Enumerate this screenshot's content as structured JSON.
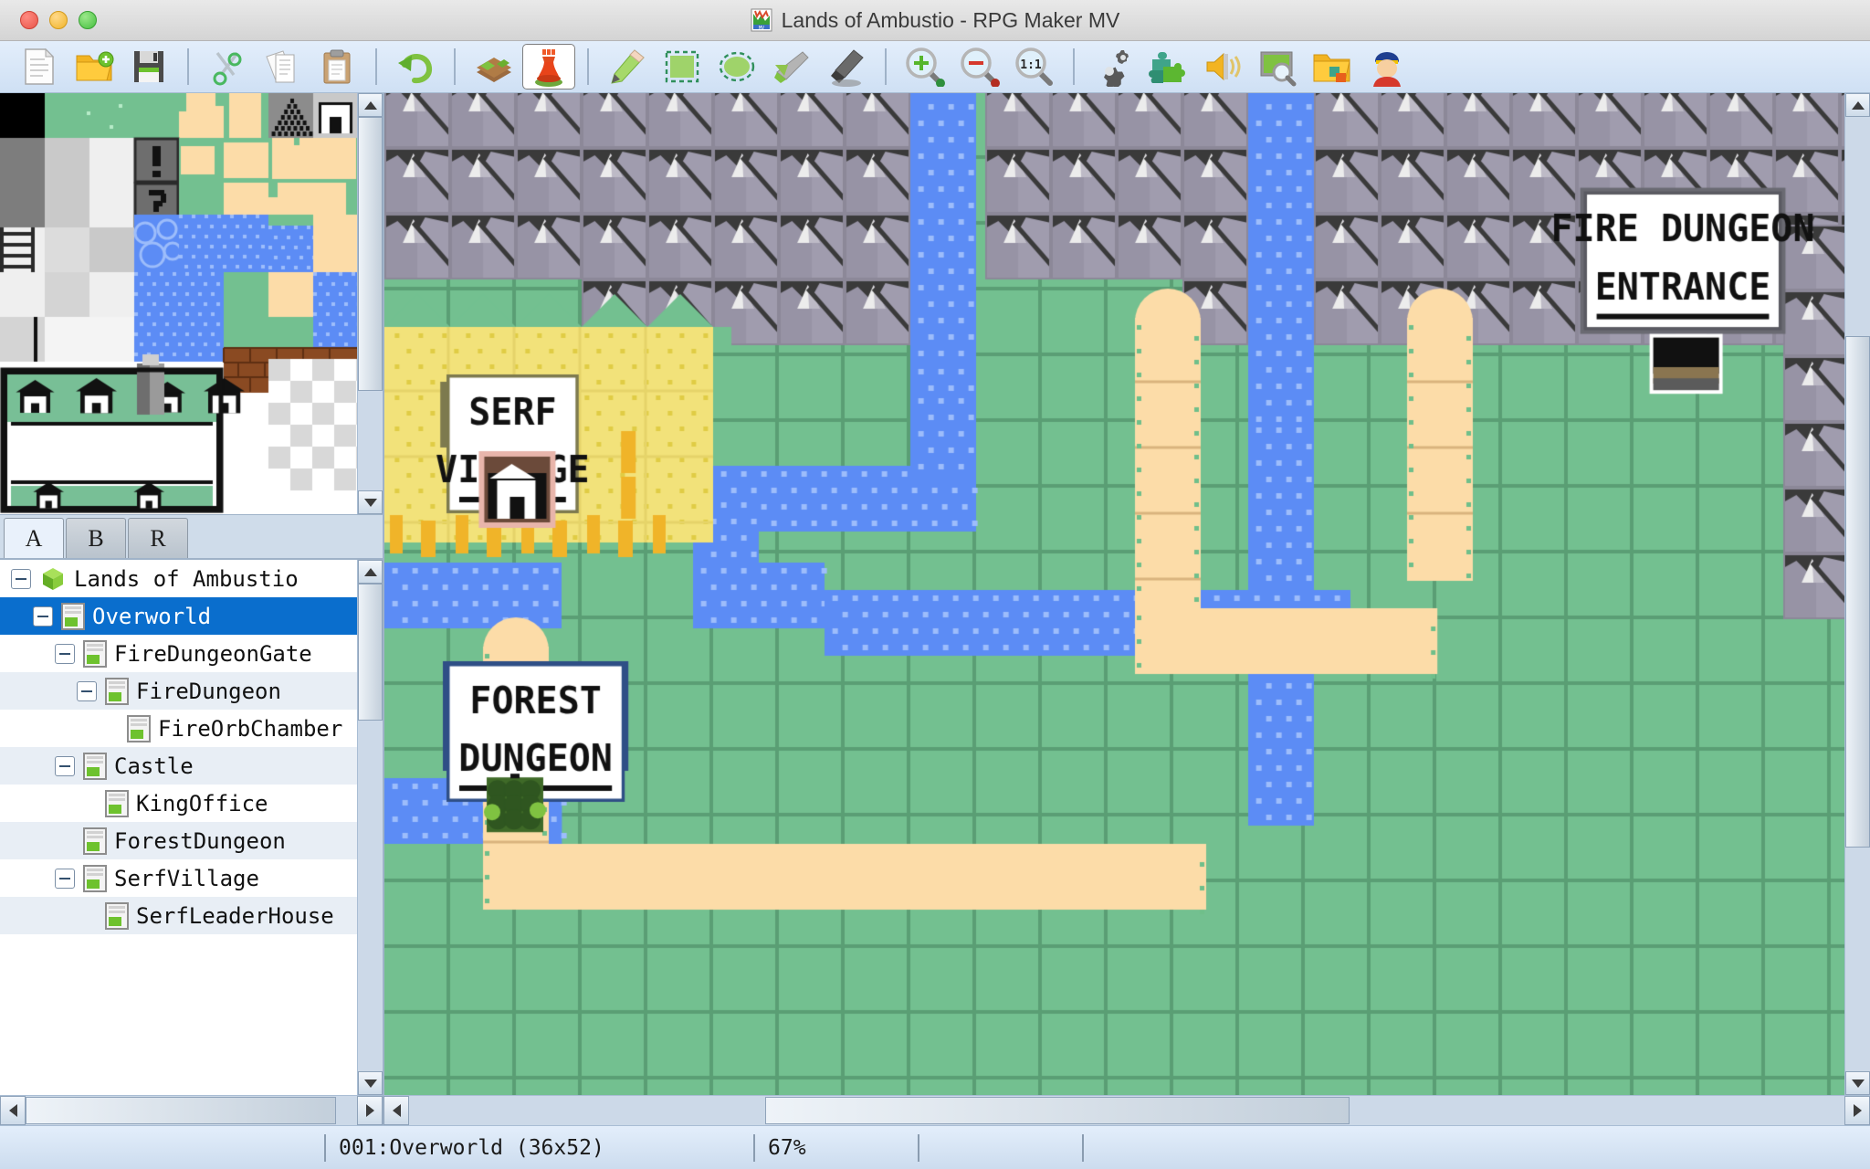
{
  "window": {
    "title": "Lands of Ambustio - RPG Maker MV",
    "app_icon": "rpgmaker-mv-icon",
    "controls": {
      "close": "close-button",
      "minimize": "minimize-button",
      "zoom": "zoom-button"
    }
  },
  "toolbar": {
    "groups": [
      {
        "items": [
          {
            "name": "new-project-button",
            "icon": "new-document-icon",
            "label": "New"
          },
          {
            "name": "open-project-button",
            "icon": "open-folder-icon",
            "label": "Open"
          },
          {
            "name": "save-project-button",
            "icon": "floppy-disk-icon",
            "label": "Save"
          }
        ]
      },
      {
        "items": [
          {
            "name": "cut-button",
            "icon": "scissors-icon",
            "label": "Cut"
          },
          {
            "name": "copy-button",
            "icon": "copy-pages-icon",
            "label": "Copy"
          },
          {
            "name": "paste-button",
            "icon": "clipboard-icon",
            "label": "Paste"
          }
        ]
      },
      {
        "items": [
          {
            "name": "undo-button",
            "icon": "undo-arrow-icon",
            "label": "Undo"
          }
        ]
      },
      {
        "items": [
          {
            "name": "map-mode-button",
            "icon": "map-layer-icon",
            "label": "Map",
            "selected": false
          },
          {
            "name": "event-mode-button",
            "icon": "event-pawn-icon",
            "label": "Event",
            "selected": true
          }
        ]
      },
      {
        "items": [
          {
            "name": "pencil-tool-button",
            "icon": "pencil-icon",
            "label": "Pencil"
          },
          {
            "name": "rectangle-tool-button",
            "icon": "rectangle-icon",
            "label": "Rectangle"
          },
          {
            "name": "ellipse-tool-button",
            "icon": "ellipse-icon",
            "label": "Ellipse"
          },
          {
            "name": "fill-tool-button",
            "icon": "paint-bucket-icon",
            "label": "Flood Fill"
          },
          {
            "name": "shadow-pen-button",
            "icon": "shadow-pen-icon",
            "label": "Shadow Pen"
          }
        ]
      },
      {
        "items": [
          {
            "name": "zoom-in-button",
            "icon": "magnifier-plus-icon",
            "label": "Zoom In"
          },
          {
            "name": "zoom-out-button",
            "icon": "magnifier-minus-icon",
            "label": "Zoom Out"
          },
          {
            "name": "zoom-actual-button",
            "icon": "magnifier-one-to-one-icon",
            "label": "Actual Size"
          }
        ]
      },
      {
        "items": [
          {
            "name": "database-button",
            "icon": "gears-icon",
            "label": "Database"
          },
          {
            "name": "plugin-manager-button",
            "icon": "puzzle-piece-icon",
            "label": "Plugin Manager"
          },
          {
            "name": "sound-test-button",
            "icon": "speaker-icon",
            "label": "Sound Test"
          },
          {
            "name": "playtest-button",
            "icon": "monitor-search-icon",
            "label": "Playtest"
          },
          {
            "name": "resource-manager-button",
            "icon": "resource-folder-icon",
            "label": "Resource Manager"
          },
          {
            "name": "character-generator-button",
            "icon": "character-head-icon",
            "label": "Character Generator"
          }
        ]
      }
    ]
  },
  "tileset_panel": {
    "name": "tileset-palette",
    "tabs": [
      {
        "label": "A",
        "name": "tab-tileset-a",
        "active": true
      },
      {
        "label": "B",
        "name": "tab-tileset-b",
        "active": false
      },
      {
        "label": "R",
        "name": "tab-tileset-r",
        "active": false
      }
    ]
  },
  "map_tree": {
    "items": [
      {
        "label": "Lands of Ambustio",
        "depth": 0,
        "icon": "project-cube-icon",
        "toggle": "minus",
        "selected": false
      },
      {
        "label": "Overworld",
        "depth": 1,
        "icon": "map-icon",
        "toggle": "minus",
        "selected": true
      },
      {
        "label": "FireDungeonGate",
        "depth": 2,
        "icon": "map-icon",
        "toggle": "minus",
        "selected": false
      },
      {
        "label": "FireDungeon",
        "depth": 3,
        "icon": "map-icon",
        "toggle": "minus",
        "selected": false
      },
      {
        "label": "FireOrbChamber",
        "depth": 4,
        "icon": "map-icon",
        "toggle": "none",
        "selected": false
      },
      {
        "label": "Castle",
        "depth": 2,
        "icon": "map-icon",
        "toggle": "minus",
        "selected": false
      },
      {
        "label": "KingOffice",
        "depth": 3,
        "icon": "map-icon",
        "toggle": "none",
        "selected": false
      },
      {
        "label": "ForestDungeon",
        "depth": 2,
        "icon": "map-icon",
        "toggle": "none",
        "selected": false
      },
      {
        "label": "SerfVillage",
        "depth": 2,
        "icon": "map-icon",
        "toggle": "minus",
        "selected": false
      },
      {
        "label": "SerfLeaderHouse",
        "depth": 3,
        "icon": "map-icon",
        "toggle": "none",
        "selected": false
      }
    ]
  },
  "map_canvas": {
    "name": "map-editor-canvas",
    "signs": [
      {
        "text": "SERF VILLAGE",
        "name": "sign-serf-village"
      },
      {
        "text": "FIRE DUNGEON ENTRANCE",
        "name": "sign-fire-dungeon-entrance"
      },
      {
        "text": "FOREST DUNGEON",
        "name": "sign-forest-dungeon"
      }
    ],
    "colors": {
      "grass": "#73c090",
      "grass_line": "#5a9e74",
      "water": "#5c8cf5",
      "water_dot": "#9dbdfb",
      "water_deep": "#2e5496",
      "path": "#fcdca8",
      "path_line": "#d9b47e",
      "sand": "#f2e27a",
      "mountain": "#a09cae",
      "mountain_dark": "#3a3a3a",
      "mountain_snow": "#ececec",
      "wheat": "#f0b429"
    }
  },
  "status_bar": {
    "map_info": "001:Overworld (36x52)",
    "zoom": "67%",
    "cell3": "",
    "cell4": ""
  }
}
